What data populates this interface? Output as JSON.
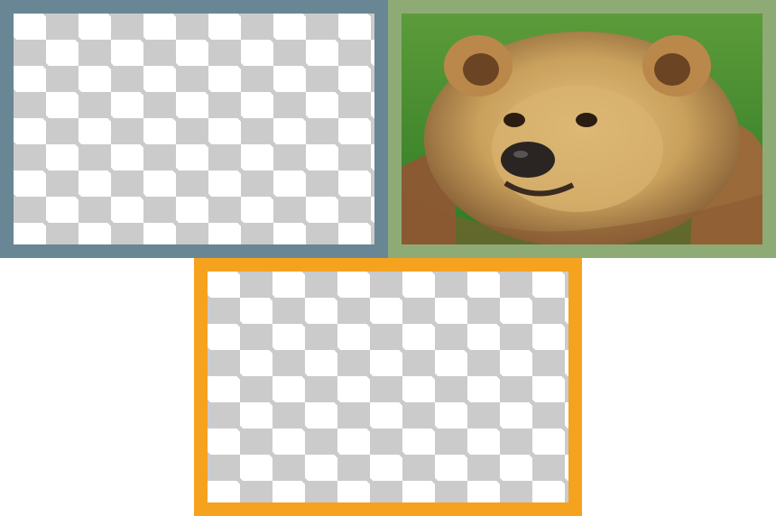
{
  "canvas": {
    "background": "#ffffff"
  },
  "panels": [
    {
      "name": "top-left",
      "border_color": "#688693",
      "content": "transparent"
    },
    {
      "name": "top-right",
      "border_color": "#8eab76",
      "content": "bear-photo"
    },
    {
      "name": "bottom-center",
      "border_color": "#f5a21f",
      "content": "transparent"
    }
  ],
  "colors": {
    "checker_light": "#ffffff",
    "checker_dark": "#cbcbcb",
    "grass": "#3f8a2a",
    "fur": "#c9a05c",
    "fur_dark": "#7a5430",
    "nose": "#2a2522"
  }
}
